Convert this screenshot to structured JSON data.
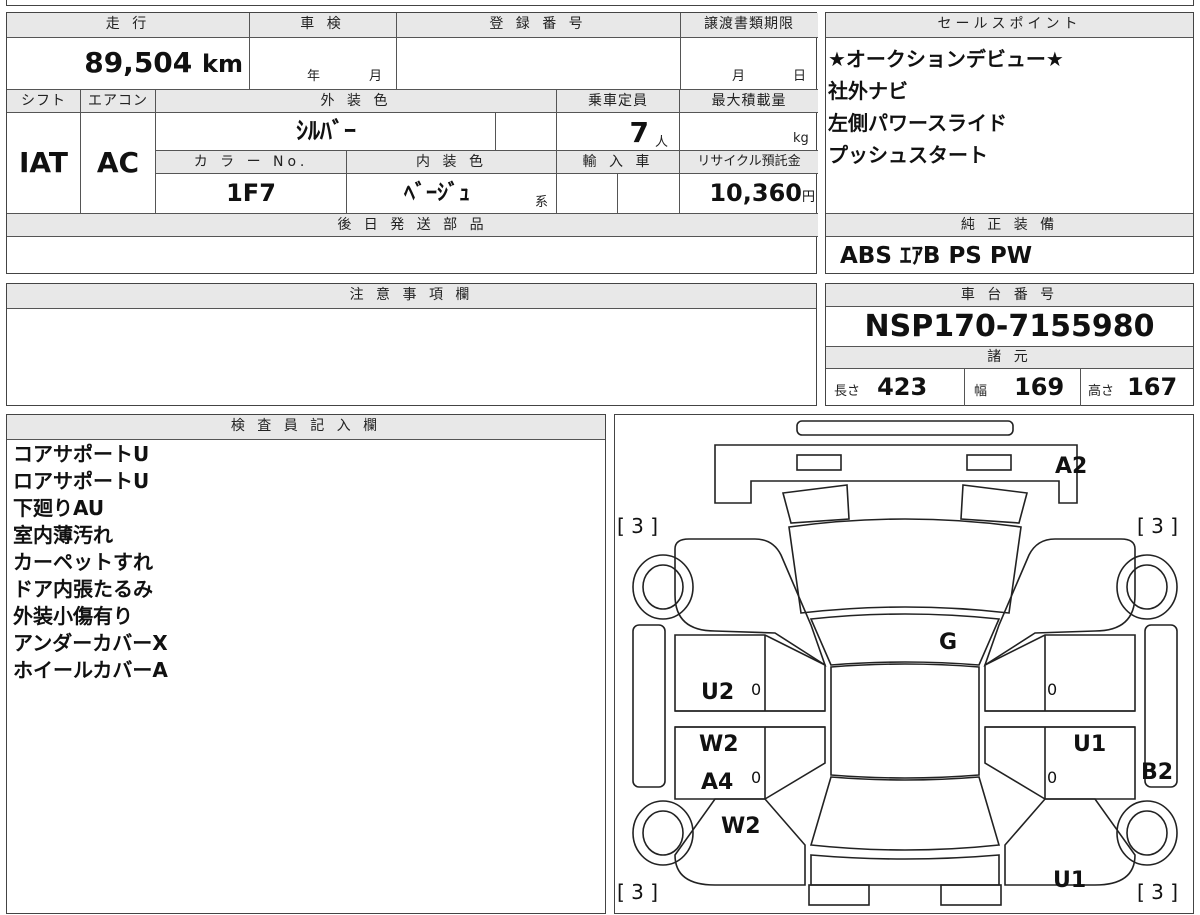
{
  "top": {
    "mileage_label": "走 行",
    "mileage_value": "89,504",
    "mileage_unit": "km",
    "inspection_label": "車 検",
    "inspection_year": "年",
    "inspection_month": "月",
    "registration_label": "登 録 番 号",
    "transfer_label": "譲渡書類期限",
    "transfer_month": "月",
    "transfer_day": "日"
  },
  "specs": {
    "shift_label": "シフト",
    "shift_value": "IAT",
    "ac_label": "エアコン",
    "ac_value": "AC",
    "exterior_label": "外 装 色",
    "exterior_value": "ｼﾙﾊﾞｰ",
    "capacity_label": "乗車定員",
    "capacity_value": "7",
    "capacity_unit": "人",
    "load_label": "最大積載量",
    "load_unit": "kg",
    "color_no_label": "カ ラ ー No.",
    "color_no_value": "1F7",
    "interior_label": "内 装 色",
    "interior_value": "ﾍﾞｰｼﾞｭ",
    "interior_suffix": "系",
    "import_label": "輸 入 車",
    "recycle_label": "リサイクル預託金",
    "recycle_value": "10,360",
    "recycle_unit": "円",
    "later_parts_label": "後 日 発 送 部 品"
  },
  "sales": {
    "title": "セールスポイント",
    "points": [
      "★オークションデビュー★",
      "社外ナビ",
      "左側パワースライド",
      "プッシュスタート"
    ]
  },
  "equipment": {
    "title": "純 正 装 備",
    "value": "ABS ｴｱB PS PW"
  },
  "notes": {
    "title": "注 意 事 項 欄"
  },
  "chassis": {
    "title": "車 台 番 号",
    "value": "NSP170-7155980"
  },
  "dimensions": {
    "title": "諸 元",
    "length_label": "長さ",
    "length_value": "423",
    "width_label": "幅",
    "width_value": "169",
    "height_label": "高さ",
    "height_value": "167"
  },
  "inspector": {
    "title": "検 査 員 記 入 欄",
    "lines": [
      "コアサポートU",
      "ロアサポートU",
      "下廻りAU",
      "室内薄汚れ",
      "カーペットすれ",
      "ドア内張たるみ",
      "外装小傷有り",
      "アンダーカバーX",
      "ホイールカバーA"
    ]
  },
  "diagram": {
    "marks": {
      "a2": "A2",
      "g": "G",
      "u2": "U2",
      "w2_door": "W2",
      "a4": "A4",
      "w2_rear": "W2",
      "u1_right": "U1",
      "b2": "B2",
      "u1_rear": "U1",
      "tl": "[ 3 ]",
      "tr": "[ 3 ]",
      "bl": "[ 3 ]",
      "br": "[ 3 ]",
      "zero1": "0",
      "zero2": "0",
      "zero3": "0",
      "zero4": "0"
    }
  }
}
